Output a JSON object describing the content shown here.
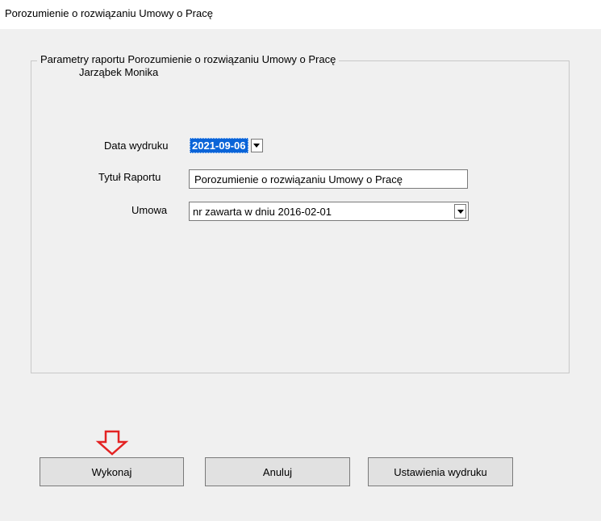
{
  "window": {
    "title": "Porozumienie o rozwiązaniu Umowy o Pracę"
  },
  "group": {
    "legend_line1": "Parametry raportu  Porozumienie o rozwiązaniu Umowy o Pracę",
    "legend_line2": "Jarząbek Monika"
  },
  "fields": {
    "date": {
      "label": "Data wydruku",
      "value": "2021-09-06"
    },
    "title": {
      "label": "Tytuł Raportu",
      "value": "Porozumienie o rozwiązaniu Umowy o Pracę"
    },
    "contract": {
      "label": "Umowa",
      "value": "nr  zawarta w dniu 2016-02-01"
    }
  },
  "buttons": {
    "execute": "Wykonaj",
    "cancel": "Anuluj",
    "print_settings": "Ustawienia wydruku"
  },
  "annotation": {
    "arrow_icon": "down-arrow-icon",
    "arrow_color": "#e32222"
  },
  "colors": {
    "selection": "#0a64d8"
  }
}
